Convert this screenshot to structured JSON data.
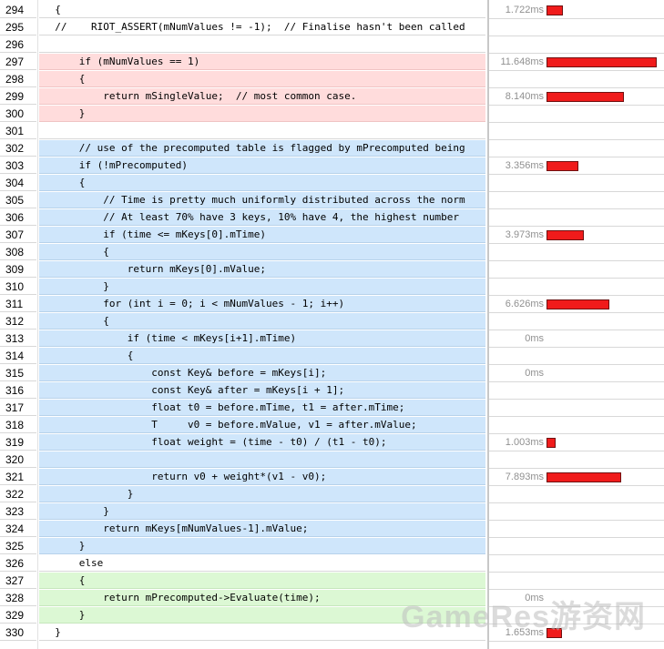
{
  "colors": {
    "red_highlight": "#ffdcdc",
    "blue_highlight": "#cfe6fb",
    "green_highlight": "#dcf8d4",
    "timing_bar": "#f01b1b"
  },
  "max_time_ms": 11.648,
  "watermark": "GameRes游资网",
  "rows": [
    {
      "line": "294",
      "code": "  {",
      "hl": "",
      "time": "1.722ms",
      "ms": 1.722
    },
    {
      "line": "295",
      "code": "  //    RIOT_ASSERT(mNumValues != -1);  // Finalise hasn't been called",
      "hl": "",
      "time": "",
      "ms": 0
    },
    {
      "line": "296",
      "code": "",
      "hl": "",
      "time": "",
      "ms": 0
    },
    {
      "line": "297",
      "code": "      if (mNumValues == 1)",
      "hl": "red",
      "time": "11.648ms",
      "ms": 11.648
    },
    {
      "line": "298",
      "code": "      {",
      "hl": "red",
      "time": "",
      "ms": 0
    },
    {
      "line": "299",
      "code": "          return mSingleValue;  // most common case.",
      "hl": "red",
      "time": "8.140ms",
      "ms": 8.14
    },
    {
      "line": "300",
      "code": "      }",
      "hl": "red",
      "time": "",
      "ms": 0
    },
    {
      "line": "301",
      "code": "",
      "hl": "",
      "time": "",
      "ms": 0
    },
    {
      "line": "302",
      "code": "      // use of the precomputed table is flagged by mPrecomputed being",
      "hl": "blue",
      "time": "",
      "ms": 0
    },
    {
      "line": "303",
      "code": "      if (!mPrecomputed)",
      "hl": "blue",
      "time": "3.356ms",
      "ms": 3.356
    },
    {
      "line": "304",
      "code": "      {",
      "hl": "blue",
      "time": "",
      "ms": 0
    },
    {
      "line": "305",
      "code": "          // Time is pretty much uniformly distributed across the norm",
      "hl": "blue",
      "time": "",
      "ms": 0
    },
    {
      "line": "306",
      "code": "          // At least 70% have 3 keys, 10% have 4, the highest number",
      "hl": "blue",
      "time": "",
      "ms": 0
    },
    {
      "line": "307",
      "code": "          if (time <= mKeys[0].mTime)",
      "hl": "blue",
      "time": "3.973ms",
      "ms": 3.973
    },
    {
      "line": "308",
      "code": "          {",
      "hl": "blue",
      "time": "",
      "ms": 0
    },
    {
      "line": "309",
      "code": "              return mKeys[0].mValue;",
      "hl": "blue",
      "time": "",
      "ms": 0
    },
    {
      "line": "310",
      "code": "          }",
      "hl": "blue",
      "time": "",
      "ms": 0
    },
    {
      "line": "311",
      "code": "          for (int i = 0; i < mNumValues - 1; i++)",
      "hl": "blue",
      "time": "6.626ms",
      "ms": 6.626
    },
    {
      "line": "312",
      "code": "          {",
      "hl": "blue",
      "time": "",
      "ms": 0
    },
    {
      "line": "313",
      "code": "              if (time < mKeys[i+1].mTime)",
      "hl": "blue",
      "time": "0ms",
      "ms": 0
    },
    {
      "line": "314",
      "code": "              {",
      "hl": "blue",
      "time": "",
      "ms": 0
    },
    {
      "line": "315",
      "code": "                  const Key& before = mKeys[i];",
      "hl": "blue",
      "time": "0ms",
      "ms": 0
    },
    {
      "line": "316",
      "code": "                  const Key& after = mKeys[i + 1];",
      "hl": "blue",
      "time": "",
      "ms": 0
    },
    {
      "line": "317",
      "code": "                  float t0 = before.mTime, t1 = after.mTime;",
      "hl": "blue",
      "time": "",
      "ms": 0
    },
    {
      "line": "318",
      "code": "                  T     v0 = before.mValue, v1 = after.mValue;",
      "hl": "blue",
      "time": "",
      "ms": 0
    },
    {
      "line": "319",
      "code": "                  float weight = (time - t0) / (t1 - t0);",
      "hl": "blue",
      "time": "1.003ms",
      "ms": 1.003
    },
    {
      "line": "320",
      "code": "",
      "hl": "blue",
      "time": "",
      "ms": 0
    },
    {
      "line": "321",
      "code": "                  return v0 + weight*(v1 - v0);",
      "hl": "blue",
      "time": "7.893ms",
      "ms": 7.893
    },
    {
      "line": "322",
      "code": "              }",
      "hl": "blue",
      "time": "",
      "ms": 0
    },
    {
      "line": "323",
      "code": "          }",
      "hl": "blue",
      "time": "",
      "ms": 0
    },
    {
      "line": "324",
      "code": "          return mKeys[mNumValues-1].mValue;",
      "hl": "blue",
      "time": "",
      "ms": 0
    },
    {
      "line": "325",
      "code": "      }",
      "hl": "blue",
      "time": "",
      "ms": 0
    },
    {
      "line": "326",
      "code": "      else",
      "hl": "",
      "time": "",
      "ms": 0
    },
    {
      "line": "327",
      "code": "      {",
      "hl": "green",
      "time": "",
      "ms": 0
    },
    {
      "line": "328",
      "code": "          return mPrecomputed->Evaluate(time);",
      "hl": "green",
      "time": "0ms",
      "ms": 0
    },
    {
      "line": "329",
      "code": "      }",
      "hl": "green",
      "time": "",
      "ms": 0
    },
    {
      "line": "330",
      "code": "  }",
      "hl": "",
      "time": "1.653ms",
      "ms": 1.653
    }
  ]
}
